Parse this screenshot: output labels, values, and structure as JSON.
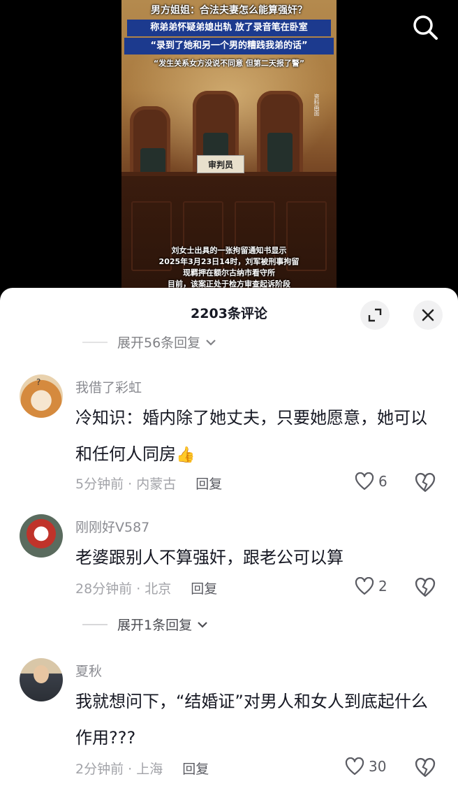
{
  "video": {
    "captions": [
      "男方姐姐：合法夫妻怎么能算强奸？",
      "称弟弟怀疑弟媳出轨 放了录音笔在卧室",
      "“录到了她和另一个男的糟践我弟的话”",
      "“发生关系女方没说不同意 但第二天报了警”"
    ],
    "nameplate": "审判员",
    "side_note": "资料画面",
    "subtitles": [
      "刘女士出具的一张拘留通知书显示",
      "2025年3月23日14时，刘军被刑事拘留",
      "现羁押在额尔古纳市看守所",
      "目前，该案正处于检方审查起诉阶段"
    ]
  },
  "icons": {
    "search": "search-icon",
    "expand": "expand-icon",
    "close": "close-icon",
    "heart": "heart-icon",
    "dislike": "broken-heart-icon",
    "chevron": "chevron-down-icon"
  },
  "sheet": {
    "title": "2203条评论",
    "top_reply_toggle": "展开56条回复"
  },
  "comments": [
    {
      "user": "我借了彩虹",
      "text": "冷知识：婚内除了她丈夫，只要她愿意，她可以和任何人同房",
      "emoji": "👍",
      "time_location": "5分钟前 · 内蒙古",
      "reply": "回复",
      "likes": "6"
    },
    {
      "user": "刚刚好V587",
      "text": "老婆跟别人不算强奸，跟老公可以算",
      "time_location": "28分钟前 · 北京",
      "reply": "回复",
      "likes": "2",
      "reply_toggle": "展开1条回复"
    },
    {
      "user": "夏秋",
      "text": "我就想问下，“结婚证”对男人和女人到底起什么作用???",
      "time_location": "2分钟前 · 上海",
      "reply": "回复",
      "likes": "30"
    }
  ]
}
